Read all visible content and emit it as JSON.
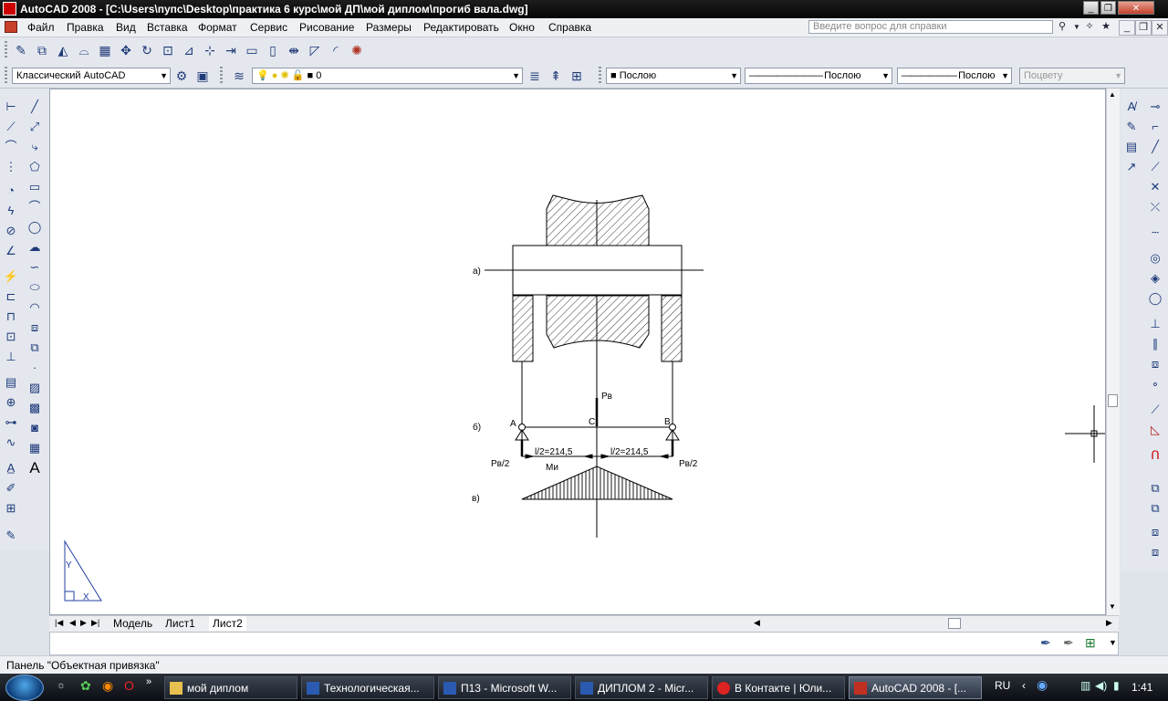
{
  "window": {
    "title": "AutoCAD 2008 - [C:\\Users\\пупс\\Desktop\\практика 6 курс\\мой ДП\\мой диплом\\прогиб вала.dwg]"
  },
  "menu": {
    "items": [
      "Файл",
      "Правка",
      "Вид",
      "Вставка",
      "Формат",
      "Сервис",
      "Рисование",
      "Размеры",
      "Редактировать",
      "Окно",
      "Справка"
    ],
    "help_placeholder": "Введите вопрос для справки"
  },
  "toolbar2": {
    "workspace": "Классический AutoCAD",
    "layer": "0",
    "color": "Послою",
    "linetype": "Послою",
    "lineweight": "Послою",
    "plotstyle": "Поцвету"
  },
  "drawing": {
    "label_a": "а)",
    "label_b": "б)",
    "label_v": "в)",
    "force": "Pв",
    "point_A": "A",
    "point_C": "C",
    "point_B": "B",
    "dim_left": "l/2=214,5",
    "dim_right": "l/2=214,5",
    "reaction_left": "Pв/2",
    "reaction_right": "Pв/2",
    "moment": "Mи",
    "ucs_y": "Y",
    "ucs_x": "X"
  },
  "tabs": [
    "Модель",
    "Лист1",
    "Лист2"
  ],
  "status": {
    "text": "Панель \"Объектная привязка\""
  },
  "taskbar": {
    "tasks": [
      "мой диплом",
      "Технологическая...",
      "П13 - Microsoft W...",
      "ДИПЛОМ 2 - Micr...",
      "В Контакте | Юли...",
      "AutoCAD 2008 - [..."
    ],
    "lang": "RU",
    "clock": "1:41"
  }
}
